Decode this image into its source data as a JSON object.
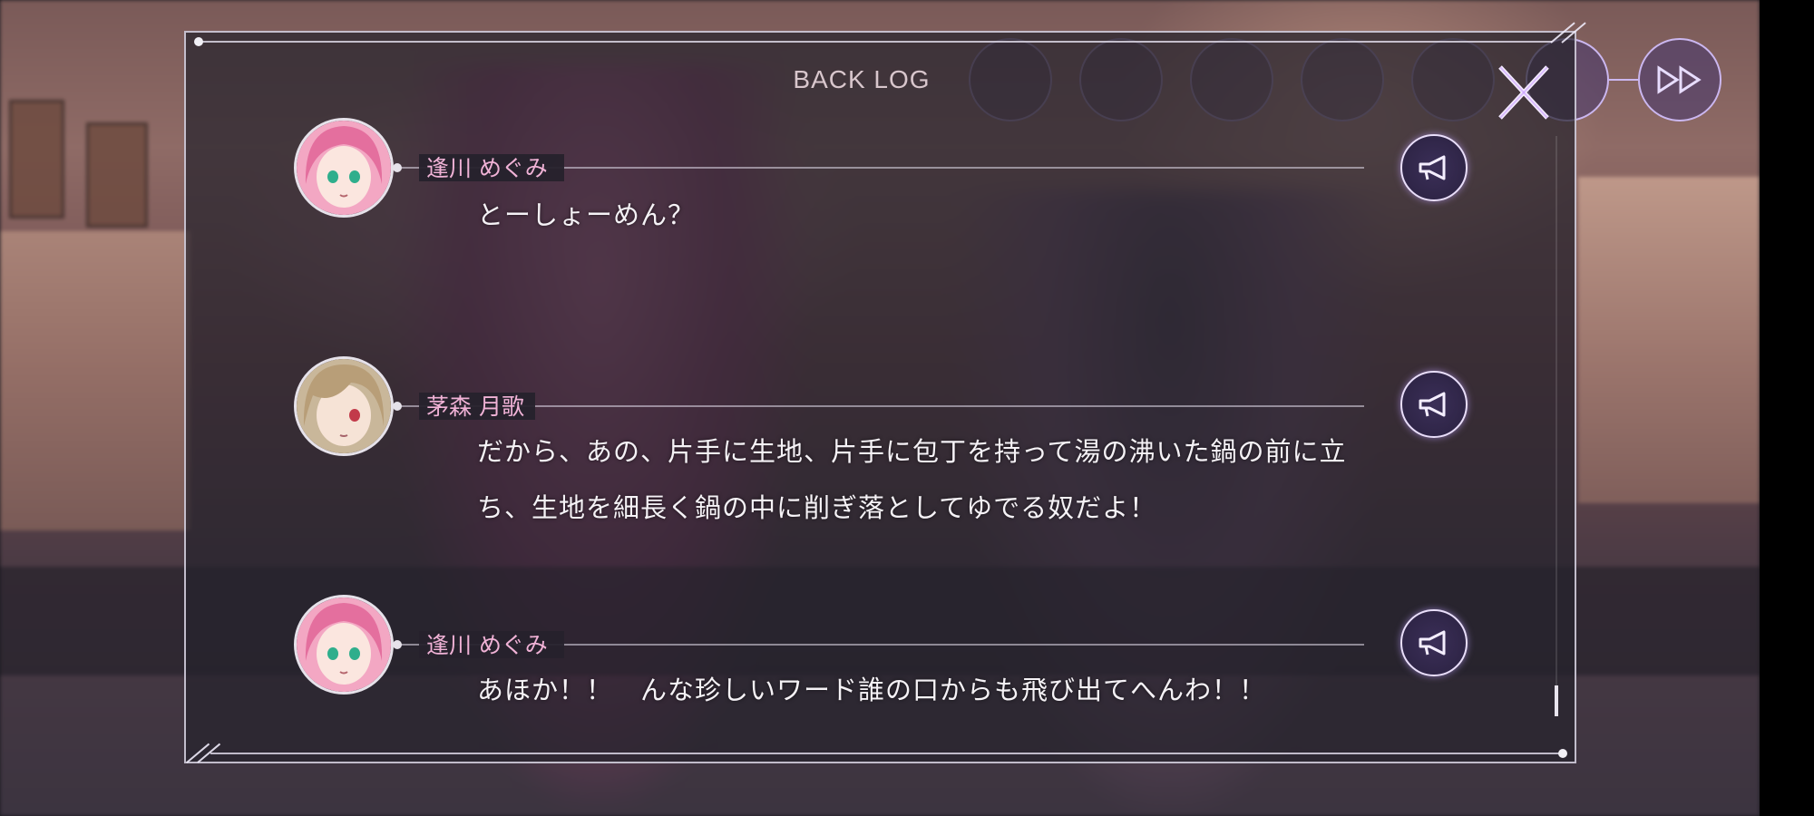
{
  "backlog": {
    "title": "BACK LOG",
    "entries": [
      {
        "speaker": "逢川 めぐみ",
        "text": "とーしょーめん？",
        "avatar": "pink-hair-avatar"
      },
      {
        "speaker": "茅森 月歌",
        "text": "だから、あの、片手に生地、片手に包丁を持って湯の沸いた鍋の前に立ち、生地を細長く鍋の中に削ぎ落としてゆでる奴だよ！",
        "avatar": "blonde-hair-avatar"
      },
      {
        "speaker": "逢川 めぐみ",
        "text": "あほか！！　んな珍しいワード誰の口からも飛び出てへんわ！！",
        "avatar": "pink-hair-avatar"
      }
    ]
  },
  "icons": {
    "close": "close-icon",
    "voice": "megaphone-icon",
    "fast_forward": "fast-forward-icon"
  },
  "colors": {
    "speaker_name": "#f0b2d6",
    "dialogue_text": "#f5f2f6",
    "accent": "#cbb7f0",
    "panel_border": "#dcd7e6"
  }
}
